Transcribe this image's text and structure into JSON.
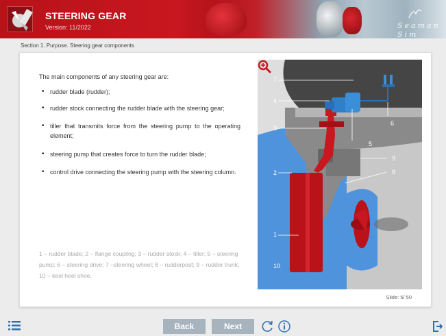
{
  "header": {
    "title": "STEERING GEAR",
    "version": "Version: 11/2022",
    "brand": "Seaman Sim"
  },
  "breadcrumb": "Section 1. Purpose. Steering gear components",
  "content": {
    "intro": "The main components of any steering gear are:",
    "bullets": [
      "rudder blade (rudder);",
      "rudder stock connecting the rudder blade with the steering gear;",
      "tiller that transmits force from the steering pump to the operating element;",
      "steering pump that creates force to turn the rudder blade;",
      "control drive connecting the steering pump with the steering column."
    ],
    "legend": "1 – rudder blade; 2 – flange coupling; 3 – rudder stock; 4 – tiller; 5 – steering pump; 6 – steering drive; 7 –steering wheel; 8 – rudderpost; 9 – rudder trunk; 10 – keel heel shoe."
  },
  "diagram": {
    "labels": [
      "7",
      "4",
      "6",
      "3",
      "5",
      "9",
      "2",
      "8",
      "1",
      "10"
    ],
    "colors": {
      "red": "#c8171f",
      "blue": "#4f93dc",
      "dark": "#555555",
      "highlight": "#c8171f"
    },
    "zoom_icon": "zoom-in-icon"
  },
  "slide": "Slide: 5/ 50",
  "footer": {
    "back_label": "Back",
    "next_label": "Next",
    "menu_icon": "list-menu-icon",
    "reload_icon": "reload-icon",
    "info_icon": "info-icon",
    "exit_icon": "exit-icon"
  }
}
